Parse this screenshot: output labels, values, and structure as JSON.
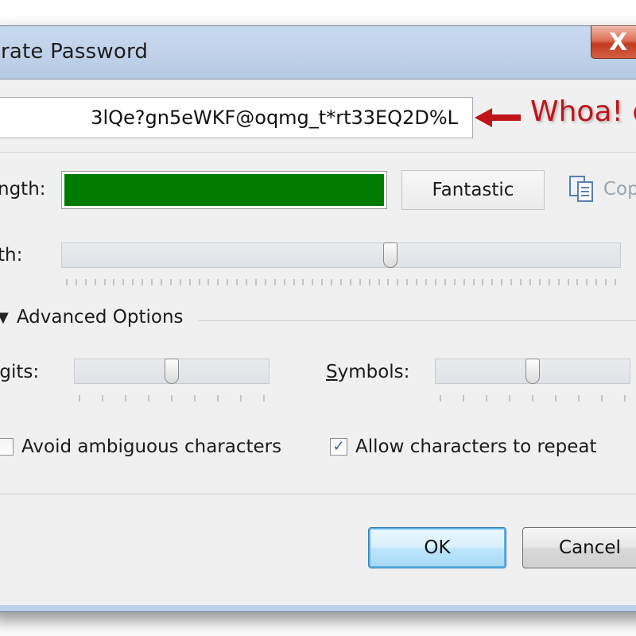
{
  "window": {
    "title": "rate Password",
    "close_glyph": "X"
  },
  "password": {
    "value": "3lQe?gn5eWKF@oqmg_t*rt33EQ2D%L"
  },
  "annotation": {
    "text": "Whoa! o",
    "color": "#c0141b"
  },
  "strength": {
    "label": "ngth:",
    "rating": "Fantastic",
    "fill_fraction": 1.0,
    "color": "#007b00"
  },
  "copy": {
    "label": "Cop",
    "icon": "copy-icon"
  },
  "length": {
    "label": "th:",
    "slider_fraction": 0.59
  },
  "advanced": {
    "label": "Advanced Options",
    "digits": {
      "label_pre": "igits:",
      "slider_fraction": 0.5
    },
    "symbols": {
      "label_u": "S",
      "label_rest": "ymbols:",
      "slider_fraction": 0.5
    },
    "avoid_ambiguous": {
      "label": "Avoid ambiguous characters",
      "checked": false
    },
    "allow_repeat": {
      "label": "Allow characters to repeat",
      "checked": true
    }
  },
  "buttons": {
    "ok": "OK",
    "cancel": "Cancel"
  }
}
